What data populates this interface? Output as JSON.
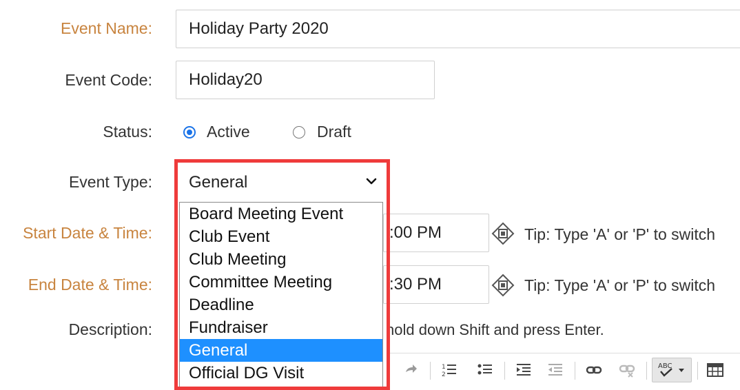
{
  "form": {
    "event_name": {
      "label": "Event Name:",
      "value": "Holiday Party 2020"
    },
    "event_code": {
      "label": "Event Code:",
      "value": "Holiday20"
    },
    "status": {
      "label": "Status:",
      "options": [
        "Active",
        "Draft"
      ],
      "selected": "Active"
    },
    "event_type": {
      "label": "Event Type:",
      "value": "General",
      "options": [
        "Board Meeting Event",
        "Club Event",
        "Club Meeting",
        "Committee Meeting",
        "Deadline",
        "Fundraiser",
        "General",
        "Official DG Visit"
      ]
    },
    "start": {
      "label": "Start Date & Time:",
      "time_partial": ":00 PM",
      "tip": "Tip: Type 'A' or 'P' to switch"
    },
    "end": {
      "label": "End Date & Time:",
      "time_partial": ":30 PM",
      "tip": "Tip: Type 'A' or 'P' to switch"
    },
    "description": {
      "label": "Description:",
      "hint_partial": "hold down Shift and press Enter."
    }
  },
  "colors": {
    "required_label": "#c8843f",
    "accent": "#1a73e8",
    "highlight": "#ef3b3b",
    "selected_option": "#1e90ff"
  },
  "toolbar_icons": [
    "redo-icon",
    "numbered-list-icon",
    "bullet-list-icon",
    "indent-icon",
    "outdent-icon",
    "link-icon",
    "unlink-icon",
    "spellcheck-icon",
    "table-icon"
  ]
}
